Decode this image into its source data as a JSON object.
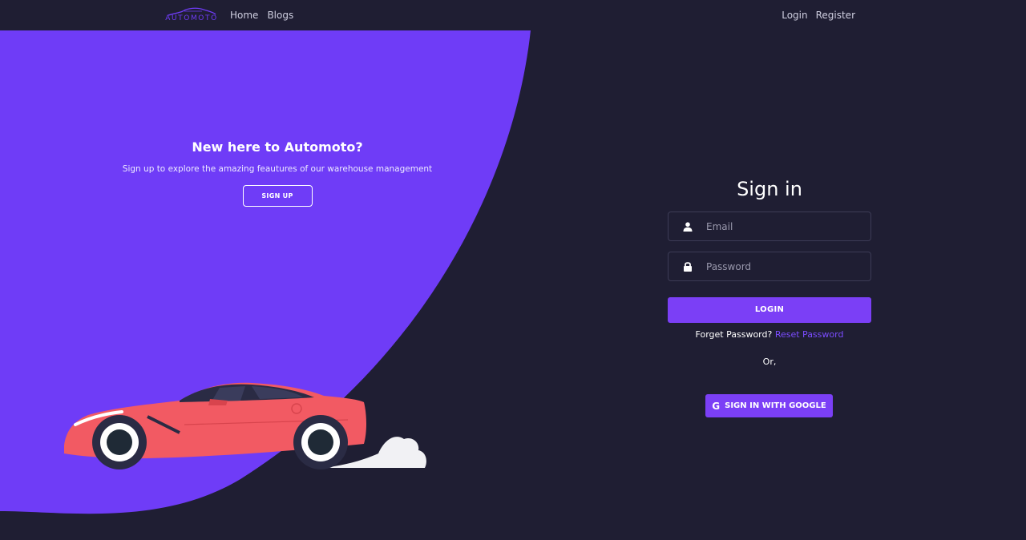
{
  "nav": {
    "logo_text": "AUTOMOTO",
    "links_left": [
      {
        "label": "Home"
      },
      {
        "label": "Blogs"
      }
    ],
    "links_right": [
      {
        "label": "Login"
      },
      {
        "label": "Register"
      }
    ]
  },
  "hero": {
    "title": "New here to Automoto?",
    "subtitle": "Sign up to explore the amazing feautures of our warehouse management",
    "signup_label": "SIGN UP"
  },
  "signin": {
    "title": "Sign in",
    "email_placeholder": "Email",
    "password_placeholder": "Password",
    "login_label": "LOGIN",
    "forgot_text": "Forget Password?",
    "reset_link": "Reset Password",
    "or_text": "Or,",
    "google_icon": "G",
    "google_label": "SIGN IN WITH GOOGLE"
  },
  "colors": {
    "background": "#1f1e33",
    "accent": "#6f3cf7",
    "button": "#7b3ff6",
    "link": "#7b4cff",
    "car": "#f25a63"
  },
  "icons": {
    "email": "user-icon",
    "password": "lock-icon",
    "google": "google-icon"
  }
}
